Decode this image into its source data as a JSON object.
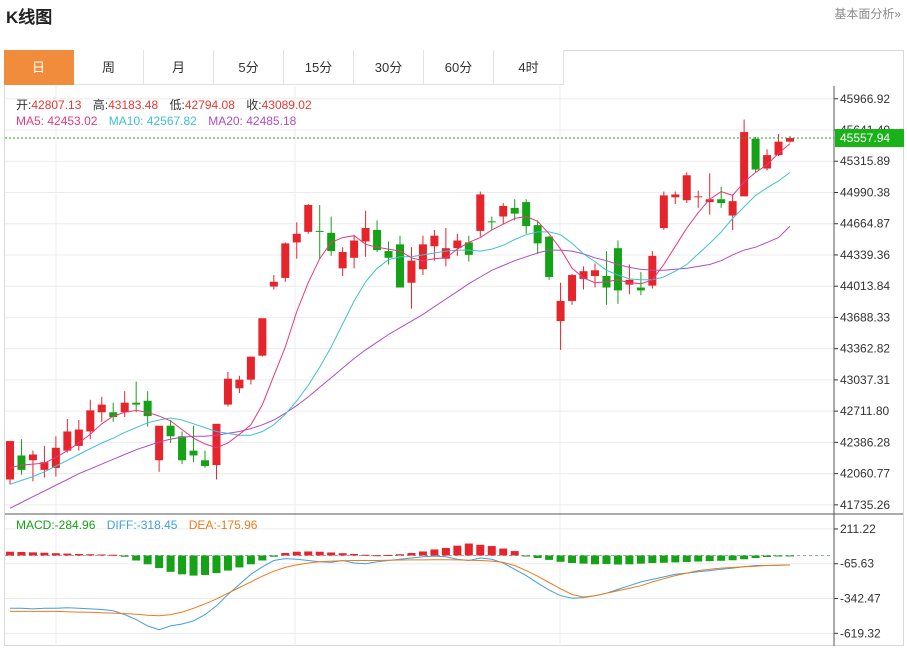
{
  "header": {
    "title": "K线图",
    "basic_link": "基本面分析»"
  },
  "tabs": [
    "日",
    "周",
    "月",
    "5分",
    "15分",
    "30分",
    "60分",
    "4时"
  ],
  "active_tab": 0,
  "ohlc": {
    "open_label": "开:",
    "open": "42807.13",
    "high_label": "高:",
    "high": "43183.48",
    "low_label": "低:",
    "low": "42794.08",
    "close_label": "收:",
    "close": "43089.02"
  },
  "ma": {
    "ma5_label": "MA5:",
    "ma5": "42453.02",
    "ma10_label": "MA10:",
    "ma10": "42567.82",
    "ma20_label": "MA20:",
    "ma20": "42485.18"
  },
  "macd": {
    "macd_label": "MACD:",
    "macd": "-284.96",
    "diff_label": "DIFF:",
    "diff": "-318.45",
    "dea_label": "DEA:",
    "dea": "-175.96"
  },
  "price_axis": [
    "45966.92",
    "45641.40",
    "45315.89",
    "44990.38",
    "44664.87",
    "44339.36",
    "44013.84",
    "43688.33",
    "43362.82",
    "43037.31",
    "42711.80",
    "42386.28",
    "42060.77",
    "41735.26"
  ],
  "current_price": "45557.94",
  "macd_axis": [
    "211.22",
    "-65.63",
    "-342.47",
    "-619.32"
  ],
  "colors": {
    "up": "#e5252b",
    "down": "#16a216",
    "ma5": "#e8387f",
    "ma10": "#3fc0d8",
    "ma20": "#b04dc6",
    "diff": "#3fa0e0",
    "dea": "#f07a1a",
    "accent": "#f08c3c",
    "price_line": "#2e9e2e"
  },
  "chart_data": {
    "type": "candlestick",
    "ylim": [
      41735.26,
      45966.92
    ],
    "candles": [
      [
        42000,
        42400,
        41950,
        42400
      ],
      [
        42250,
        42420,
        42050,
        42100
      ],
      [
        42200,
        42300,
        41980,
        42260
      ],
      [
        42100,
        42350,
        42020,
        42180
      ],
      [
        42120,
        42450,
        42030,
        42330
      ],
      [
        42300,
        42630,
        42280,
        42500
      ],
      [
        42350,
        42620,
        42300,
        42520
      ],
      [
        42500,
        42830,
        42420,
        42720
      ],
      [
        42700,
        42860,
        42600,
        42780
      ],
      [
        42700,
        42800,
        42600,
        42650
      ],
      [
        42700,
        42920,
        42650,
        42800
      ],
      [
        42800,
        43020,
        42700,
        42780
      ],
      [
        42820,
        42920,
        42550,
        42660
      ],
      [
        42200,
        42520,
        42080,
        42560
      ],
      [
        42560,
        42620,
        42380,
        42450
      ],
      [
        42450,
        42500,
        42160,
        42200
      ],
      [
        42300,
        42560,
        42180,
        42250
      ],
      [
        42200,
        42300,
        42120,
        42140
      ],
      [
        42150,
        42570,
        42000,
        42580
      ],
      [
        42780,
        43120,
        42760,
        43050
      ],
      [
        42950,
        43080,
        42900,
        43040
      ],
      [
        43040,
        43260,
        42990,
        43280
      ],
      [
        43290,
        43620,
        43280,
        43680
      ],
      [
        44010,
        44130,
        43980,
        44060
      ],
      [
        44100,
        44470,
        44060,
        44460
      ],
      [
        44470,
        44680,
        44300,
        44560
      ],
      [
        44580,
        44870,
        44560,
        44860
      ],
      [
        44590,
        44860,
        44300,
        44580
      ],
      [
        44570,
        44740,
        44330,
        44380
      ],
      [
        44200,
        44420,
        44120,
        44370
      ],
      [
        44310,
        44550,
        44200,
        44490
      ],
      [
        44480,
        44800,
        44320,
        44620
      ],
      [
        44600,
        44700,
        44370,
        44390
      ],
      [
        44380,
        44480,
        44240,
        44310
      ],
      [
        44450,
        44540,
        44000,
        44000
      ],
      [
        44050,
        44420,
        43780,
        44280
      ],
      [
        44190,
        44540,
        44130,
        44450
      ],
      [
        44430,
        44600,
        44280,
        44540
      ],
      [
        44300,
        44620,
        44220,
        44410
      ],
      [
        44410,
        44560,
        44330,
        44490
      ],
      [
        44470,
        44540,
        44270,
        44340
      ],
      [
        44590,
        45000,
        44530,
        44970
      ],
      [
        44690,
        44740,
        44600,
        44680
      ],
      [
        44740,
        44880,
        44660,
        44850
      ],
      [
        44830,
        44920,
        44700,
        44770
      ],
      [
        44890,
        44920,
        44560,
        44640
      ],
      [
        44650,
        44700,
        44350,
        44460
      ],
      [
        44530,
        44540,
        44080,
        44110
      ],
      [
        43650,
        44050,
        43350,
        43860
      ],
      [
        43860,
        44140,
        43820,
        44130
      ],
      [
        44090,
        44220,
        43980,
        44170
      ],
      [
        44120,
        44250,
        44000,
        44180
      ],
      [
        44120,
        44380,
        43820,
        44000
      ],
      [
        44410,
        44490,
        43830,
        43970
      ],
      [
        44030,
        44240,
        43930,
        44080
      ],
      [
        44000,
        44160,
        43920,
        43970
      ],
      [
        44020,
        44380,
        43990,
        44330
      ],
      [
        44620,
        45000,
        44600,
        44960
      ],
      [
        44940,
        45000,
        44870,
        44970
      ],
      [
        44910,
        45200,
        44880,
        45170
      ],
      [
        44940,
        45010,
        44830,
        44950
      ],
      [
        44890,
        45190,
        44760,
        44920
      ],
      [
        44920,
        45050,
        44830,
        44880
      ],
      [
        44750,
        44970,
        44600,
        44900
      ],
      [
        44950,
        45750,
        44950,
        45620
      ],
      [
        45550,
        45570,
        45200,
        45230
      ],
      [
        45240,
        45440,
        45220,
        45380
      ],
      [
        45380,
        45600,
        45370,
        45520
      ],
      [
        45520,
        45580,
        45510,
        45557.94
      ]
    ],
    "ma5": [
      42120,
      42150,
      42160,
      42170,
      42230,
      42300,
      42380,
      42470,
      42580,
      42660,
      42700,
      42720,
      42700,
      42660,
      42610,
      42520,
      42430,
      42370,
      42330,
      42380,
      42470,
      42570,
      42780,
      43080,
      43380,
      43750,
      44050,
      44300,
      44470,
      44520,
      44540,
      44450,
      44420,
      44400,
      44380,
      44310,
      44280,
      44300,
      44310,
      44400,
      44470,
      44520,
      44600,
      44660,
      44720,
      44740,
      44690,
      44560,
      44400,
      44200,
      44100,
      44050,
      44060,
      44080,
      44050,
      44040,
      44080,
      44240,
      44430,
      44620,
      44780,
      44920,
      45000,
      44960,
      45100,
      45200,
      45280,
      45400,
      45500
    ],
    "ma10": [
      41950,
      41990,
      42030,
      42080,
      42140,
      42200,
      42260,
      42320,
      42380,
      42430,
      42490,
      42540,
      42590,
      42620,
      42640,
      42620,
      42580,
      42540,
      42500,
      42480,
      42460,
      42460,
      42500,
      42570,
      42680,
      42820,
      42980,
      43170,
      43380,
      43620,
      43860,
      44060,
      44200,
      44290,
      44320,
      44320,
      44340,
      44360,
      44380,
      44390,
      44390,
      44380,
      44400,
      44440,
      44500,
      44550,
      44580,
      44580,
      44550,
      44460,
      44350,
      44270,
      44180,
      44130,
      44090,
      44080,
      44080,
      44110,
      44170,
      44240,
      44350,
      44460,
      44580,
      44720,
      44840,
      44960,
      45040,
      45110,
      45200
    ],
    "ma20": [
      41700,
      41760,
      41820,
      41880,
      41940,
      42000,
      42060,
      42110,
      42160,
      42210,
      42260,
      42310,
      42350,
      42390,
      42420,
      42440,
      42450,
      42450,
      42460,
      42480,
      42500,
      42530,
      42570,
      42620,
      42690,
      42770,
      42860,
      42960,
      43060,
      43160,
      43260,
      43350,
      43430,
      43510,
      43580,
      43650,
      43720,
      43800,
      43880,
      43960,
      44040,
      44110,
      44180,
      44230,
      44280,
      44320,
      44360,
      44390,
      44390,
      44380,
      44350,
      44310,
      44280,
      44240,
      44210,
      44190,
      44180,
      44180,
      44190,
      44200,
      44220,
      44240,
      44280,
      44340,
      44390,
      44420,
      44470,
      44520,
      44640
    ],
    "macd_ylim": [
      -619.32,
      211.22
    ],
    "macd_hist": [
      30,
      28,
      25,
      22,
      18,
      15,
      12,
      10,
      8,
      6,
      -10,
      -40,
      -70,
      -100,
      -130,
      -150,
      -160,
      -155,
      -140,
      -120,
      -95,
      -70,
      -40,
      -10,
      20,
      30,
      32,
      30,
      24,
      18,
      12,
      6,
      2,
      4,
      10,
      20,
      32,
      48,
      60,
      78,
      95,
      85,
      75,
      55,
      35,
      -5,
      -20,
      -35,
      -50,
      -60,
      -65,
      -70,
      -68,
      -72,
      -70,
      -65,
      -60,
      -58,
      -55,
      -52,
      -48,
      -45,
      -42,
      -38,
      -30,
      -20,
      -12,
      -8,
      -6
    ],
    "diff": [
      -420,
      -420,
      -425,
      -420,
      -420,
      -415,
      -420,
      -425,
      -430,
      -440,
      -470,
      -510,
      -560,
      -590,
      -560,
      -545,
      -520,
      -470,
      -400,
      -310,
      -230,
      -150,
      -90,
      -40,
      -25,
      -30,
      -40,
      -50,
      -55,
      -40,
      -60,
      -65,
      -50,
      -40,
      -30,
      -20,
      -10,
      -5,
      -10,
      -30,
      -40,
      -20,
      -30,
      -60,
      -110,
      -160,
      -220,
      -275,
      -320,
      -340,
      -335,
      -320,
      -300,
      -270,
      -240,
      -210,
      -190,
      -170,
      -150,
      -140,
      -130,
      -120,
      -110,
      -100,
      -90,
      -80,
      -80,
      -78,
      -75
    ],
    "dea": [
      -445,
      -445,
      -445,
      -445,
      -445,
      -448,
      -450,
      -452,
      -455,
      -458,
      -462,
      -468,
      -475,
      -480,
      -470,
      -450,
      -420,
      -385,
      -345,
      -300,
      -255,
      -210,
      -165,
      -125,
      -95,
      -75,
      -60,
      -50,
      -45,
      -42,
      -40,
      -40,
      -40,
      -38,
      -36,
      -35,
      -35,
      -34,
      -34,
      -35,
      -38,
      -40,
      -45,
      -55,
      -80,
      -120,
      -165,
      -215,
      -265,
      -310,
      -330,
      -320,
      -300,
      -280,
      -260,
      -240,
      -210,
      -185,
      -160,
      -140,
      -120,
      -110,
      -100,
      -95,
      -90,
      -85,
      -80,
      -78,
      -76
    ]
  }
}
